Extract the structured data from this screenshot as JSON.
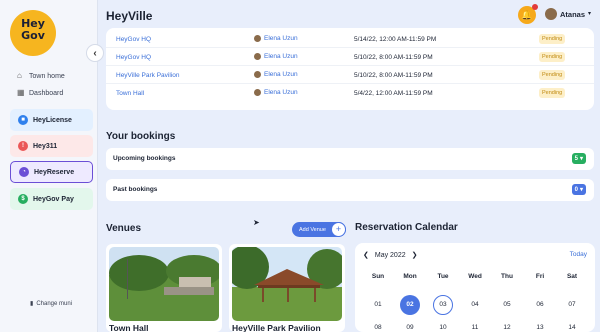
{
  "logo": {
    "line1": "Hey",
    "line2": "Gov"
  },
  "sidebar": {
    "nav": [
      {
        "label": "Town home",
        "icon": "home-icon"
      },
      {
        "label": "Dashboard",
        "icon": "grid-icon"
      }
    ],
    "products": [
      {
        "label": "HeyLicense",
        "color": "#2f80ed",
        "bg": "#e3f0ff"
      },
      {
        "label": "Hey311",
        "color": "#eb5757",
        "bg": "#fde8e8"
      },
      {
        "label": "HeyReserve",
        "color": "#6b4fd6",
        "bg": "#eeeaff"
      },
      {
        "label": "HeyGov Pay",
        "color": "#27ae60",
        "bg": "#e3f7ec"
      }
    ],
    "change_muni": "Change muni"
  },
  "header": {
    "title": "HeyVille",
    "user_name": "Atanas"
  },
  "reservations": [
    {
      "venue": "HeyGov HQ",
      "user": "Elena Uzun",
      "dates": "5/14/22, 12:00 AM-11:59 PM",
      "status": "Pending"
    },
    {
      "venue": "HeyGov HQ",
      "user": "Elena Uzun",
      "dates": "5/10/22, 8:00 AM-11:59 PM",
      "status": "Pending"
    },
    {
      "venue": "HeyVille Park Pavilion",
      "user": "Elena Uzun",
      "dates": "5/10/22, 8:00 AM-11:59 PM",
      "status": "Pending"
    },
    {
      "venue": "Town Hall",
      "user": "Elena Uzun",
      "dates": "5/4/22, 12:00 AM-11:59 PM",
      "status": "Pending"
    }
  ],
  "bookings": {
    "title": "Your bookings",
    "upcoming": {
      "label": "Upcoming bookings",
      "count": "5",
      "color": "#27ae60"
    },
    "past": {
      "label": "Past bookings",
      "count": "0",
      "color": "#4a74e2"
    }
  },
  "venues": {
    "title": "Venues",
    "add_label": "Add Venue",
    "items": [
      {
        "name": "Town Hall"
      },
      {
        "name": "HeyVille Park Pavilion"
      }
    ]
  },
  "calendar": {
    "title": "Reservation Calendar",
    "month": "May 2022",
    "today_label": "Today",
    "weekdays": [
      "Sun",
      "Mon",
      "Tue",
      "Wed",
      "Thu",
      "Fri",
      "Sat"
    ],
    "week1": [
      "01",
      "02",
      "03",
      "04",
      "05",
      "06",
      "07"
    ],
    "week2": [
      "08",
      "09",
      "10",
      "11",
      "12",
      "13",
      "14"
    ],
    "selected_day": "02",
    "today_day": "03"
  }
}
